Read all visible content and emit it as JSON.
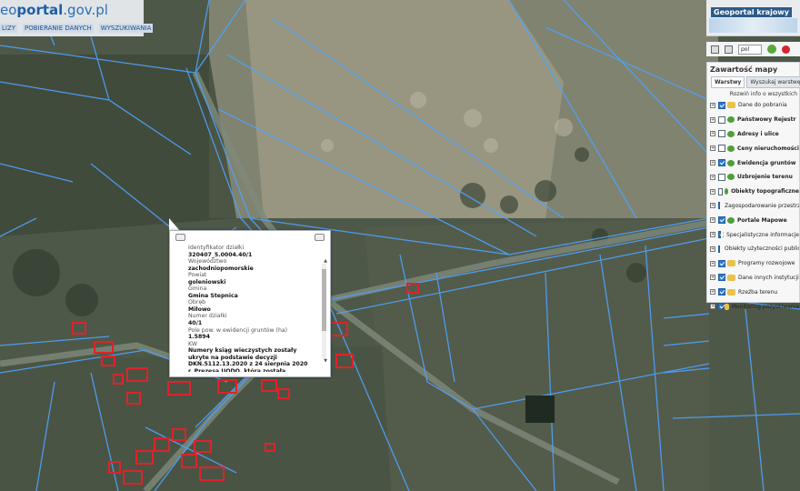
{
  "branding": {
    "logo_prefix": "eo",
    "logo_main": "portal",
    "logo_suffix": ".gov.pl",
    "nav": [
      "LIZY",
      "POBIERANIE DANYCH",
      "WYSZUKIWANIA"
    ]
  },
  "panel": {
    "title": "Geoportal krajowy",
    "language": "pol",
    "contents_title": "Zawartość mapy",
    "tabs": [
      "Warstwy",
      "Wyszukaj warstwę"
    ],
    "expand_link": "Rozwiń info o wszystkich",
    "layers": [
      {
        "label": "Dane do pobrania",
        "checked": true,
        "icon": "folder",
        "bold": false
      },
      {
        "label": "Państwowy Rejestr",
        "checked": false,
        "icon": "service",
        "bold": true
      },
      {
        "label": "Adresy i ulice",
        "checked": false,
        "icon": "service",
        "bold": true
      },
      {
        "label": "Ceny nieruchomości",
        "checked": false,
        "icon": "service",
        "bold": true
      },
      {
        "label": "Ewidencja gruntów",
        "checked": true,
        "icon": "service",
        "bold": true
      },
      {
        "label": "Uzbrojenie terenu",
        "checked": false,
        "icon": "service",
        "bold": true
      },
      {
        "label": "Obiekty topograficzne",
        "checked": false,
        "icon": "service",
        "bold": true
      },
      {
        "label": "Zagospodarowanie przestrzenne",
        "checked": true,
        "icon": "folder",
        "bold": false
      },
      {
        "label": "Portale Mapowe",
        "checked": true,
        "icon": "service",
        "bold": true
      },
      {
        "label": "Specjalistyczne informacje",
        "checked": true,
        "icon": "folder",
        "bold": false
      },
      {
        "label": "Obiekty użyteczności publicznej",
        "checked": true,
        "icon": "folder",
        "bold": false
      },
      {
        "label": "Programy rozwojowe",
        "checked": true,
        "icon": "folder",
        "bold": false
      },
      {
        "label": "Dane innych instytucji",
        "checked": true,
        "icon": "folder",
        "bold": false
      },
      {
        "label": "Rzeźba terenu",
        "checked": true,
        "icon": "folder",
        "bold": false
      },
      {
        "label": "Monitoring pozyskiwania",
        "checked": true,
        "icon": "folder",
        "bold": false
      }
    ]
  },
  "popup": {
    "lines": [
      {
        "text": "Identyfikator działki",
        "kind": "k"
      },
      {
        "text": "320407_5.0004.40/1",
        "kind": "v"
      },
      {
        "text": "Województwo",
        "kind": "k"
      },
      {
        "text": "zachodniopomorskie",
        "kind": "v"
      },
      {
        "text": "Powiat",
        "kind": "k"
      },
      {
        "text": "goleniowski",
        "kind": "v"
      },
      {
        "text": "Gmina",
        "kind": "k"
      },
      {
        "text": "Gmina Stepnica",
        "kind": "v"
      },
      {
        "text": "Obręb",
        "kind": "k"
      },
      {
        "text": "Miłowo",
        "kind": "v"
      },
      {
        "text": "Numer działki",
        "kind": "k"
      },
      {
        "text": "40/1",
        "kind": "v"
      },
      {
        "text": "Pole pow. w ewidencji gruntów (ha)",
        "kind": "k"
      },
      {
        "text": "1.5894",
        "kind": "v"
      },
      {
        "text": "KW",
        "kind": "k"
      },
      {
        "text": "Numery ksiąg wieczystych zostały",
        "kind": "v"
      },
      {
        "text": "ukryte na podstawie decyzji",
        "kind": "v"
      },
      {
        "text": "DKN.5112.13.2020 z 24 sierpnia 2020",
        "kind": "v"
      },
      {
        "text": "r. Prezesa UODO, która została",
        "kind": "v"
      }
    ]
  },
  "colors": {
    "parcel_line": "#4da3ff",
    "building": "#e0222a",
    "road": "#7f8a7c",
    "panel_bg": "#f7f7f7"
  }
}
